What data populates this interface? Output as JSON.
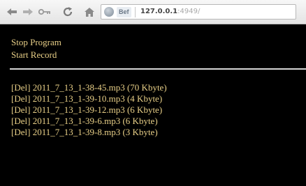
{
  "browser": {
    "url_host": "127.0.0.1",
    "url_rest": ":4949/",
    "security_tag": "Bef",
    "icons": [
      "back-arrow-icon",
      "forward-arrow-icon",
      "key-icon",
      "reload-icon",
      "home-icon",
      "globe-icon"
    ]
  },
  "page": {
    "text_color": "#e8cf87",
    "background": "#000000",
    "links": {
      "stop": "Stop Program",
      "record": "Start Record"
    },
    "files": [
      {
        "del": "[Del]",
        "info": "2011_7_13_1-38-45.mp3 (70 Kbyte)"
      },
      {
        "del": "[Del]",
        "info": "2011_7_13_1-39-10.mp3 (4 Kbyte)"
      },
      {
        "del": "[Del]",
        "info": "2011_7_13_1-39-12.mp3 (6 Kbyte)"
      },
      {
        "del": "[Del]",
        "info": "2011_7_13_1-39-6.mp3 (6 Kbyte)"
      },
      {
        "del": "[Del]",
        "info": "2011_7_13_1-39-8.mp3 (3 Kbyte)"
      }
    ]
  }
}
